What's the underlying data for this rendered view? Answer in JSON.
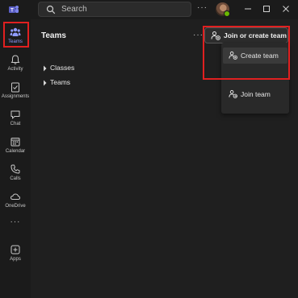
{
  "titlebar": {
    "search_placeholder": "Search",
    "more_label": "···",
    "app_icon": "teams-logo",
    "window_controls": [
      "minimize-icon",
      "maximize-icon",
      "close-icon"
    ]
  },
  "rail": {
    "items": [
      {
        "label": "Teams",
        "icon": "teams-icon",
        "active": true
      },
      {
        "label": "Activity",
        "icon": "bell-icon",
        "active": false
      },
      {
        "label": "Assignments",
        "icon": "assignments-icon",
        "active": false
      },
      {
        "label": "Chat",
        "icon": "chat-icon",
        "active": false
      },
      {
        "label": "Calendar",
        "icon": "calendar-icon",
        "active": false
      },
      {
        "label": "Calls",
        "icon": "phone-icon",
        "active": false
      },
      {
        "label": "OneDrive",
        "icon": "cloud-icon",
        "active": false
      },
      {
        "label": "Apps",
        "icon": "apps-icon",
        "active": false
      }
    ],
    "more_label": "···"
  },
  "main": {
    "title": "Teams",
    "more_label": "···",
    "join_button_label": "Join or create team",
    "menu": [
      {
        "label": "Create team",
        "icon": "create-team-icon"
      },
      {
        "label": "Join team",
        "icon": "join-team-icon"
      }
    ],
    "tree": [
      {
        "label": "Classes"
      },
      {
        "label": "Teams"
      }
    ]
  },
  "colors": {
    "accent": "#8f9bff",
    "highlight_outline": "#e02020",
    "background": "#1f1f1f",
    "rail_background": "#1b1b1b"
  }
}
